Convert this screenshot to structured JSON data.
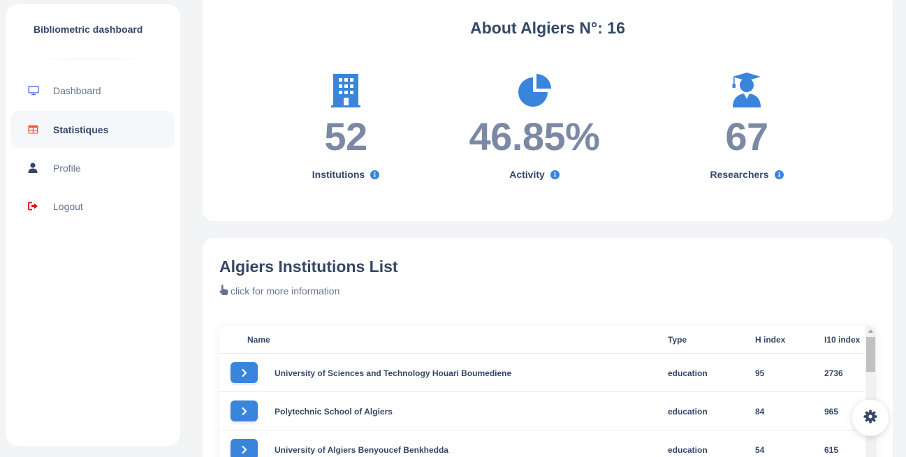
{
  "sidebar": {
    "brand": "Bibliometric dashboard",
    "items": [
      {
        "label": "Dashboard",
        "icon": "monitor-icon"
      },
      {
        "label": "Statistiques",
        "icon": "table-icon",
        "active": true
      },
      {
        "label": "Profile",
        "icon": "user-icon"
      },
      {
        "label": "Logout",
        "icon": "logout-icon"
      }
    ]
  },
  "about": {
    "title": "About Algiers N°: 16",
    "stats": [
      {
        "value": "52",
        "label": "Institutions",
        "icon": "building-icon"
      },
      {
        "value": "46.85%",
        "label": "Activity",
        "icon": "pie-chart-icon"
      },
      {
        "value": "67",
        "label": "Researchers",
        "icon": "graduate-icon"
      }
    ]
  },
  "institutions": {
    "title": "Algiers Institutions List",
    "subtitle": "click for more information",
    "columns": [
      "Name",
      "Type",
      "H index",
      "I10 index"
    ],
    "rows": [
      {
        "name": "University of Sciences and Technology Houari Boumediene",
        "type": "education",
        "h_index": "95",
        "i10_index": "2736"
      },
      {
        "name": "Polytechnic School of Algiers",
        "type": "education",
        "h_index": "84",
        "i10_index": "965"
      },
      {
        "name": "University of Algiers Benyoucef Benkhedda",
        "type": "education",
        "h_index": "54",
        "i10_index": "615"
      }
    ]
  },
  "colors": {
    "accent": "#3a85dc",
    "stat_value": "#7b89a4",
    "heading": "#344767",
    "logout": "#ea0606",
    "statistiques_icon": "#f5593d"
  }
}
